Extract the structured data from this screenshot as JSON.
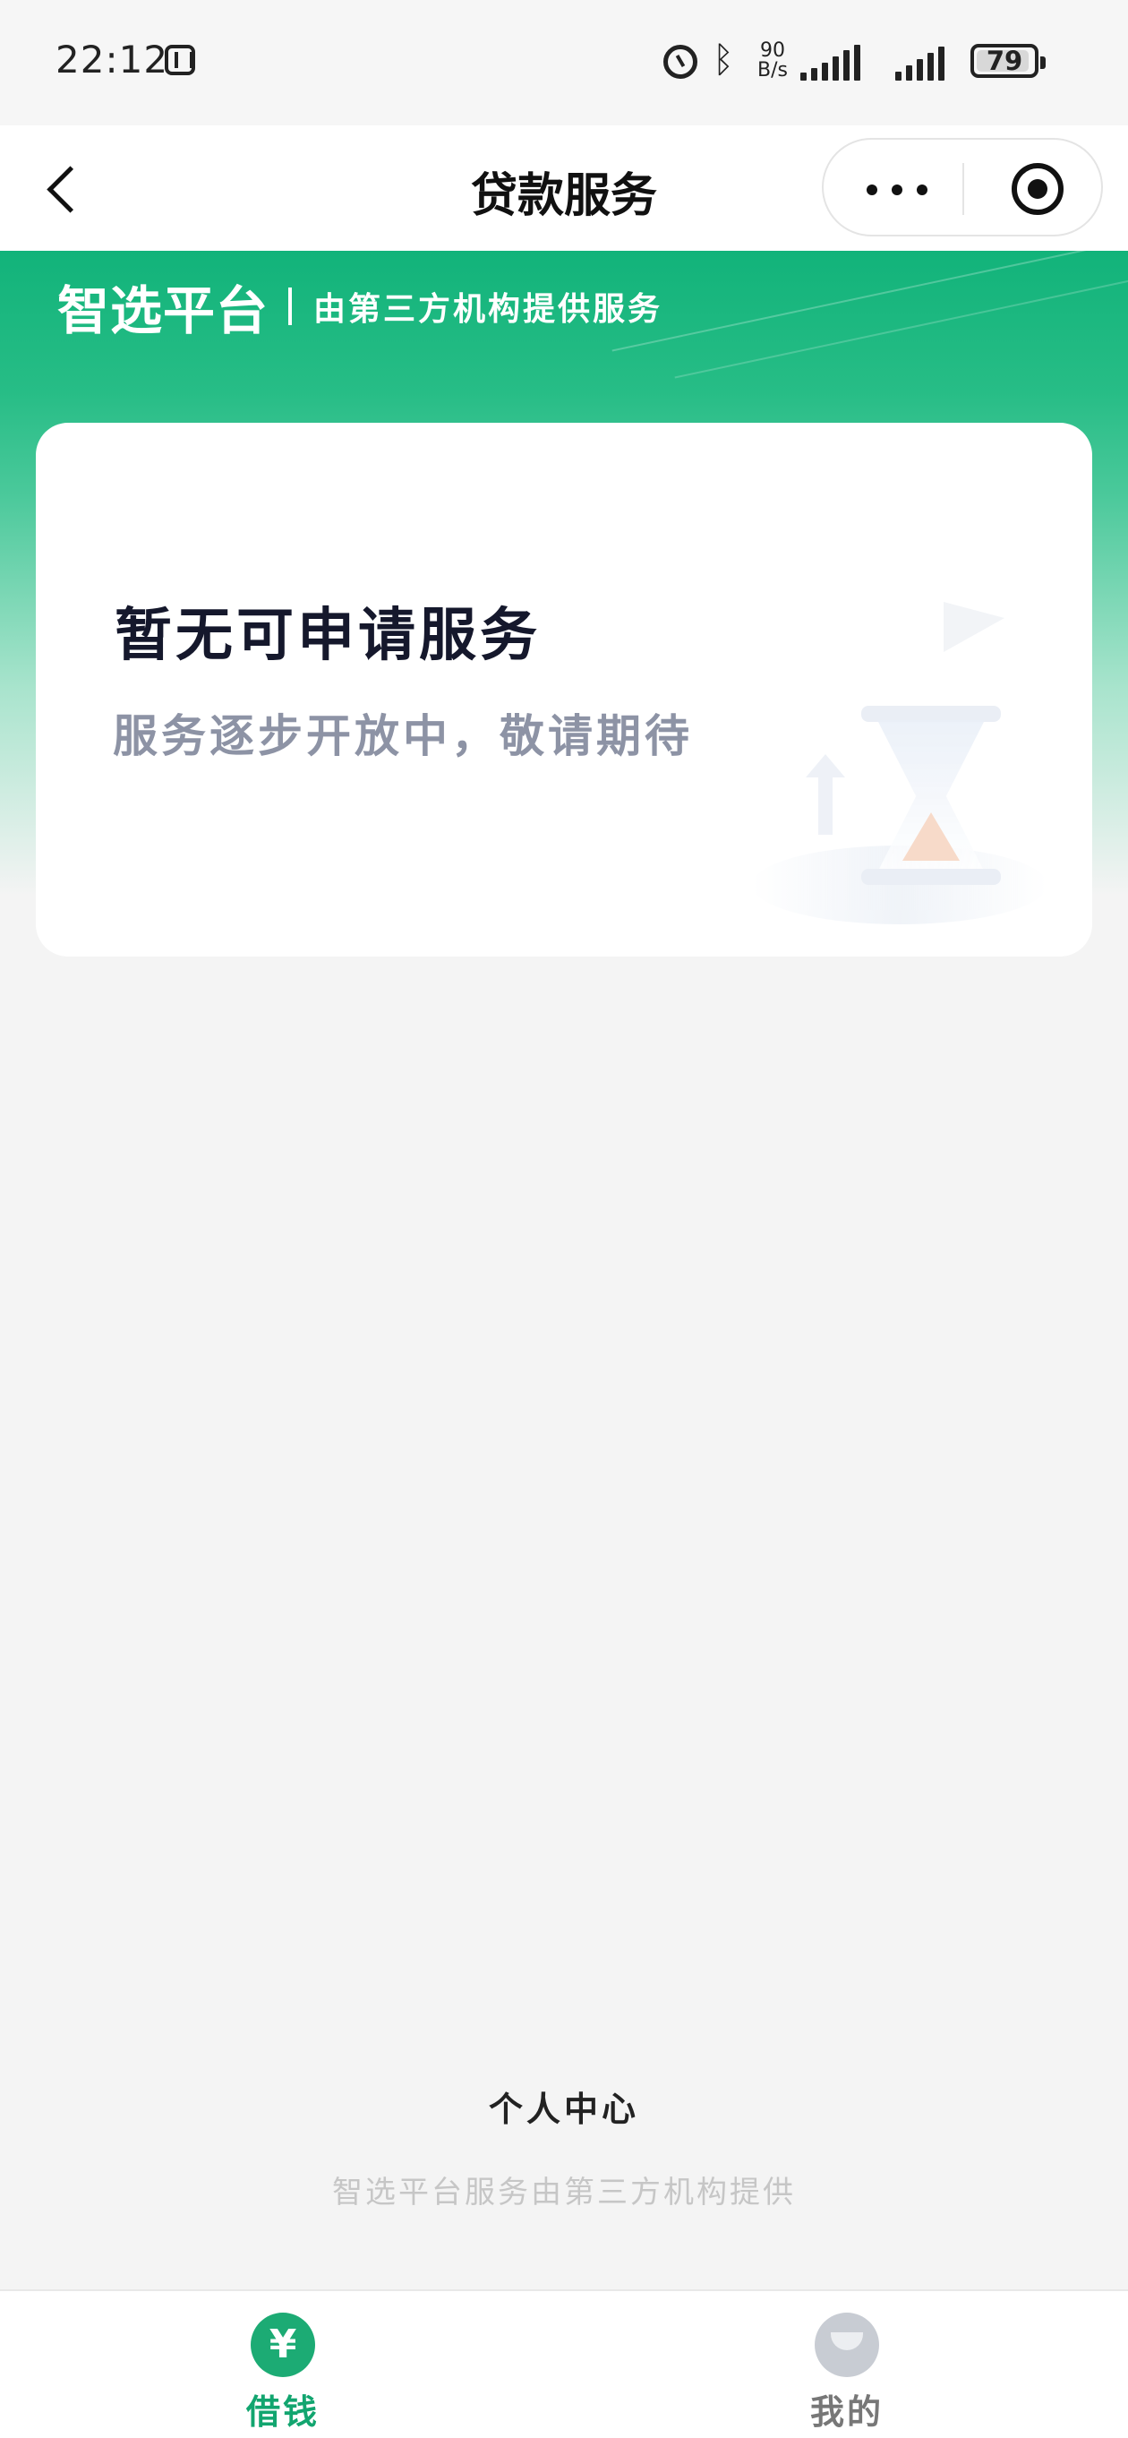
{
  "status_bar": {
    "time": "22:12",
    "network_speed": "90\nB/s",
    "battery": "79",
    "icons": [
      "nfc-icon",
      "alarm-icon",
      "bluetooth-icon",
      "signal-icon",
      "signal-icon",
      "battery-icon"
    ]
  },
  "navigation": {
    "title": "贷款服务",
    "icons": [
      "back-icon",
      "more-icon",
      "target-icon"
    ]
  },
  "hero": {
    "brand": "智选平台",
    "subtitle": "由第三方机构提供服务",
    "accent_color": "#12b37a"
  },
  "empty_state": {
    "title": "暂无可申请服务",
    "subtitle": "服务逐步开放中，敬请期待",
    "illustration_icons": [
      "paper-plane-icon",
      "hourglass-icon",
      "up-arrow-icon"
    ]
  },
  "footer": {
    "link": "个人中心",
    "note": "智选平台服务由第三方机构提供"
  },
  "tabbar": {
    "items": [
      {
        "label": "借钱",
        "icon": "yen-icon",
        "active": true,
        "icon_text": "¥"
      },
      {
        "label": "我的",
        "icon": "user-icon",
        "active": false
      }
    ],
    "active_color": "#12a56f"
  }
}
